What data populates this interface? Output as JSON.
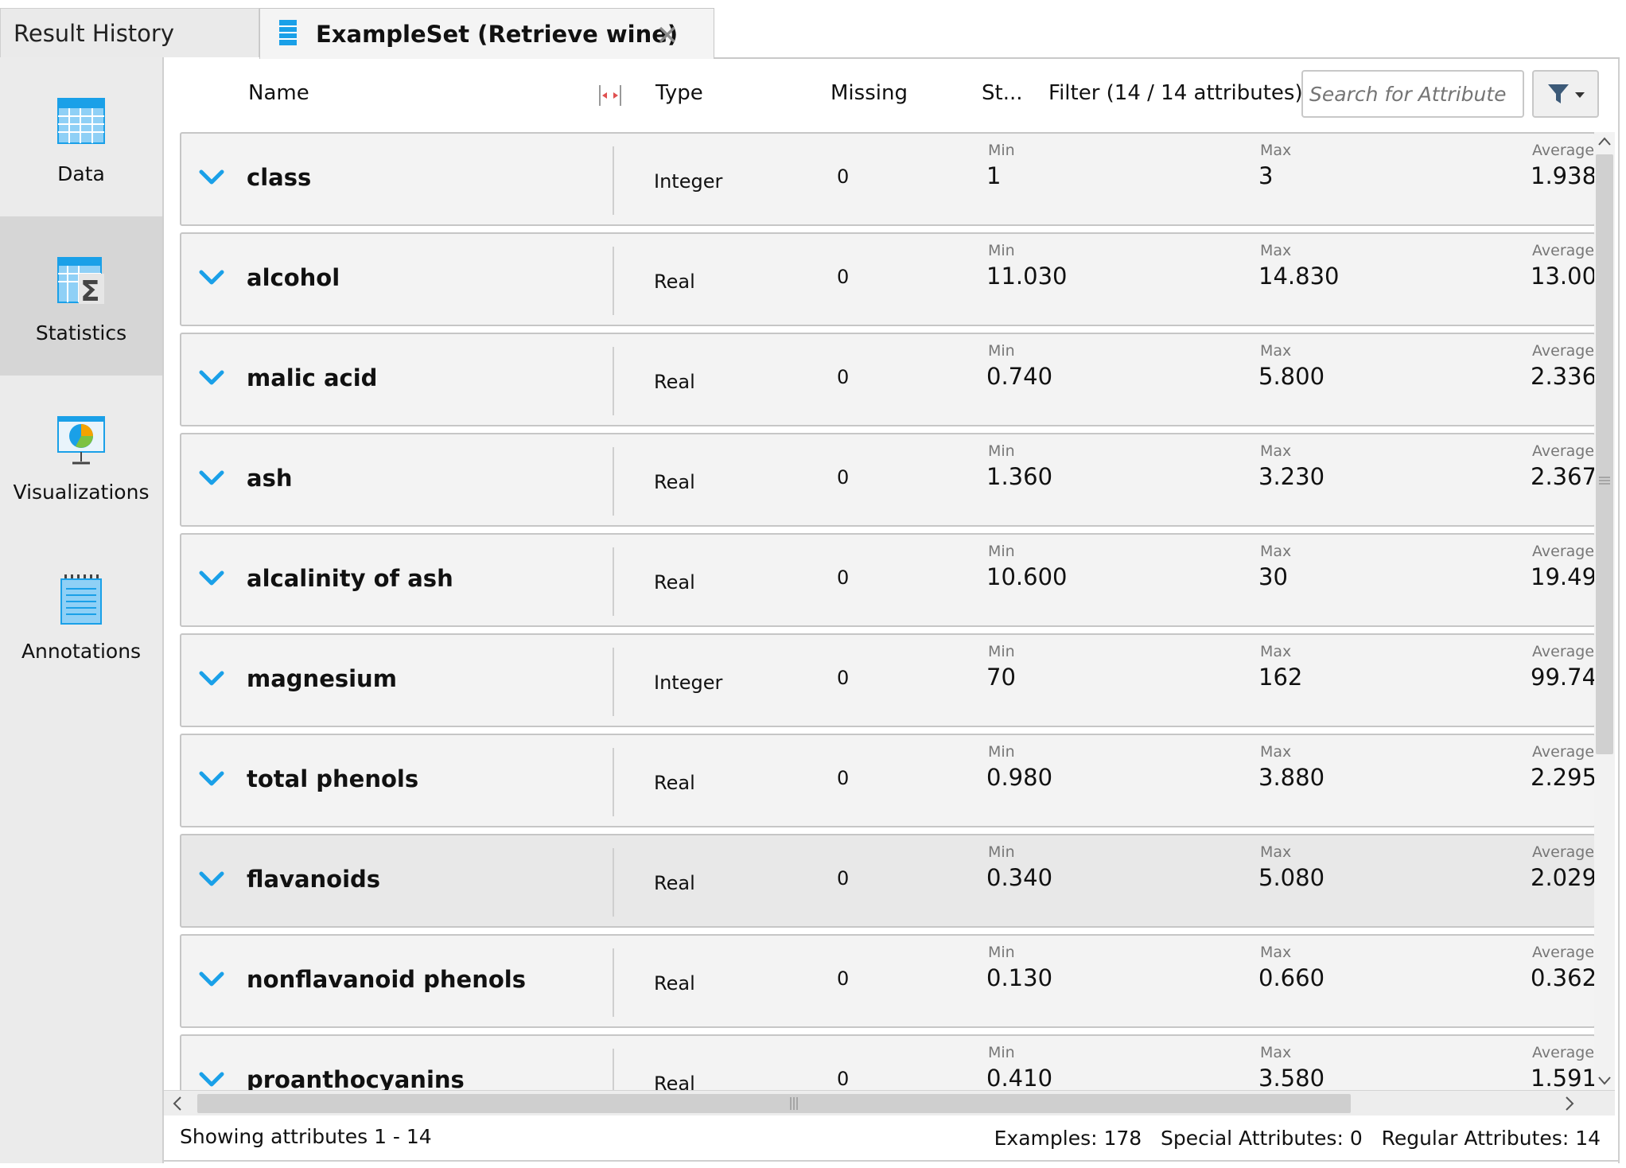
{
  "tabs": {
    "result_history": "Result History",
    "exampleset": "ExampleSet (Retrieve wine)",
    "close_glyph": "✕"
  },
  "sidebar": {
    "items": [
      {
        "label": "Data",
        "icon": "table-icon"
      },
      {
        "label": "Statistics",
        "icon": "statistics-icon"
      },
      {
        "label": "Visualizations",
        "icon": "visualizations-icon"
      },
      {
        "label": "Annotations",
        "icon": "annotations-icon"
      }
    ],
    "active": "Statistics"
  },
  "header": {
    "name": "Name",
    "type": "Type",
    "missing": "Missing",
    "stats": "St...",
    "filter": "Filter (14 / 14 attributes):",
    "search_placeholder": "Search for Attribute"
  },
  "stat_labels": {
    "min": "Min",
    "max": "Max",
    "average": "Average"
  },
  "attributes": [
    {
      "name": "class",
      "type": "Integer",
      "missing": "0",
      "min": "1",
      "max": "3",
      "average": "1.938"
    },
    {
      "name": "alcohol",
      "type": "Real",
      "missing": "0",
      "min": "11.030",
      "max": "14.830",
      "average": "13.00"
    },
    {
      "name": "malic acid",
      "type": "Real",
      "missing": "0",
      "min": "0.740",
      "max": "5.800",
      "average": "2.336"
    },
    {
      "name": "ash",
      "type": "Real",
      "missing": "0",
      "min": "1.360",
      "max": "3.230",
      "average": "2.367"
    },
    {
      "name": "alcalinity of ash",
      "type": "Real",
      "missing": "0",
      "min": "10.600",
      "max": "30",
      "average": "19.49"
    },
    {
      "name": "magnesium",
      "type": "Integer",
      "missing": "0",
      "min": "70",
      "max": "162",
      "average": "99.74"
    },
    {
      "name": "total phenols",
      "type": "Real",
      "missing": "0",
      "min": "0.980",
      "max": "3.880",
      "average": "2.295"
    },
    {
      "name": "flavanoids",
      "type": "Real",
      "missing": "0",
      "min": "0.340",
      "max": "5.080",
      "average": "2.029"
    },
    {
      "name": "nonflavanoid phenols",
      "type": "Real",
      "missing": "0",
      "min": "0.130",
      "max": "0.660",
      "average": "0.362"
    },
    {
      "name": "proanthocyanins",
      "type": "Real",
      "missing": "0",
      "min": "0.410",
      "max": "3.580",
      "average": "1.591"
    }
  ],
  "selected_row": "flavanoids",
  "footer": {
    "showing": "Showing attributes 1 - 14",
    "summary": "Examples: 178   Special Attributes: 0   Regular Attributes: 14"
  },
  "colors": {
    "accent": "#1aa0e8",
    "selected_row": "#e8e8e8",
    "row": "#f3f3f3"
  }
}
